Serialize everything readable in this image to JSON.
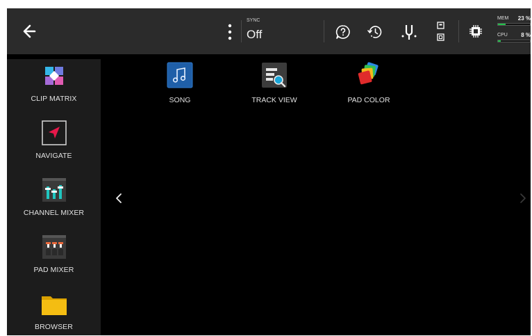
{
  "header": {
    "sync": {
      "label": "SYNC",
      "value": "Off"
    },
    "meters": {
      "mem": {
        "label": "MEM",
        "value": "23 %",
        "level": 0.23
      },
      "cpu": {
        "label": "CPU",
        "value": "8 %",
        "level": 0.08
      }
    },
    "icons": [
      "back-arrow-icon",
      "more-vertical-icon",
      "help-icon",
      "history-icon",
      "tuner-icon",
      "layout-toggle-icon",
      "cpu-chip-icon"
    ]
  },
  "sidebar": {
    "items": [
      {
        "label": "CLIP MATRIX",
        "icon": "clip-matrix-icon"
      },
      {
        "label": "NAVIGATE",
        "icon": "navigate-icon"
      },
      {
        "label": "CHANNEL MIXER",
        "icon": "channel-mixer-icon"
      },
      {
        "label": "PAD MIXER",
        "icon": "pad-mixer-icon"
      },
      {
        "label": "BROWSER",
        "icon": "folder-icon"
      }
    ]
  },
  "apps": [
    {
      "label": "SONG",
      "icon": "song-icon"
    },
    {
      "label": "TRACK VIEW",
      "icon": "track-view-icon"
    },
    {
      "label": "PAD COLOR",
      "icon": "pad-color-icon"
    }
  ],
  "pager": {
    "prev": "‹",
    "next": "›"
  },
  "colors": {
    "topbar": "#2b2b2b",
    "sidebar": "#1c1c1c",
    "background": "#000000",
    "meter": "#21c14a",
    "accent_red": "#e8184a"
  }
}
